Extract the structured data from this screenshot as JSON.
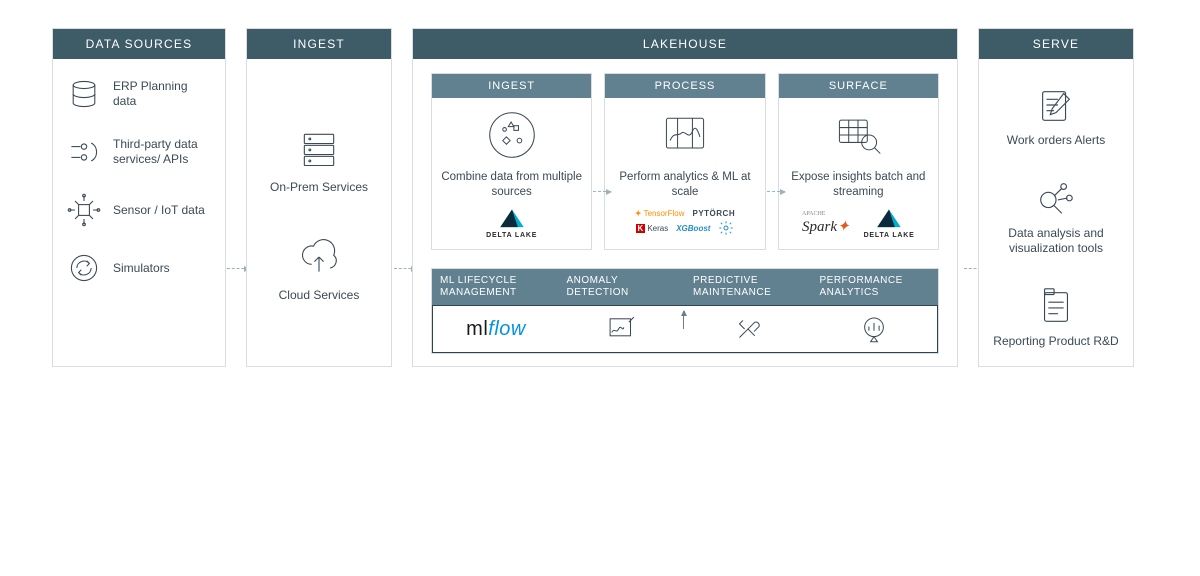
{
  "columns": {
    "sources": {
      "title": "DATA SOURCES",
      "items": [
        {
          "icon": "erp-icon",
          "label": "ERP Planning data"
        },
        {
          "icon": "api-icon",
          "label": "Third-party data services/ APIs"
        },
        {
          "icon": "iot-icon",
          "label": "Sensor / IoT data"
        },
        {
          "icon": "sim-icon",
          "label": "Simulators"
        }
      ]
    },
    "ingest": {
      "title": "INGEST",
      "items": [
        {
          "icon": "server-icon",
          "label": "On-Prem Services"
        },
        {
          "icon": "cloud-upload-icon",
          "label": "Cloud Services"
        }
      ]
    },
    "lakehouse": {
      "title": "LAKEHOUSE",
      "cards": [
        {
          "title": "INGEST",
          "desc": "Combine data from multiple sources",
          "icon": "combine-icon",
          "logos": [
            "delta-lake"
          ]
        },
        {
          "title": "PROCESS",
          "desc": "Perform analytics & ML at scale",
          "icon": "process-icon",
          "logos": [
            "tensorflow",
            "pytorch",
            "keras",
            "xgboost",
            "gear"
          ]
        },
        {
          "title": "SURFACE",
          "desc": "Expose insights batch and streaming",
          "icon": "surface-icon",
          "logos": [
            "spark",
            "delta-lake"
          ]
        }
      ],
      "bottom": {
        "headers": [
          "ML LIFECYCLE MANAGEMENT",
          "ANOMALY DETECTION",
          "PREDICTIVE MAINTENANCE",
          "PERFORMANCE ANALYTICS"
        ],
        "logos": [
          "mlflow",
          "anomaly-icon",
          "tools-icon",
          "analytics-icon"
        ]
      }
    },
    "serve": {
      "title": "SERVE",
      "items": [
        {
          "icon": "workorder-icon",
          "label": "Work orders Alerts"
        },
        {
          "icon": "dataviz-icon",
          "label": "Data analysis and visualization tools"
        },
        {
          "icon": "report-icon",
          "label": "Reporting Product R&D"
        }
      ]
    }
  },
  "tech_labels": {
    "delta_lake": "DELTA LAKE",
    "tensorflow": "TensorFlow",
    "pytorch": "PYTÖRCH",
    "keras": "Keras",
    "xgboost": "XGBoost",
    "spark_tiny": "APACHE",
    "spark": "Spark",
    "mlflow_ml": "ml",
    "mlflow_flow": "flow"
  },
  "colors": {
    "header_bg": "#3e5b68",
    "subheader_bg": "#628190",
    "border": "#d7dde1",
    "tensorflow": "#ff8f00",
    "keras": "#d00000",
    "xgboost": "#1E90C9",
    "mlflow_blue": "#0194e2",
    "spark_orange": "#e25a1c",
    "delta_cyan": "#00add4",
    "delta_dark": "#0b2a3a"
  }
}
